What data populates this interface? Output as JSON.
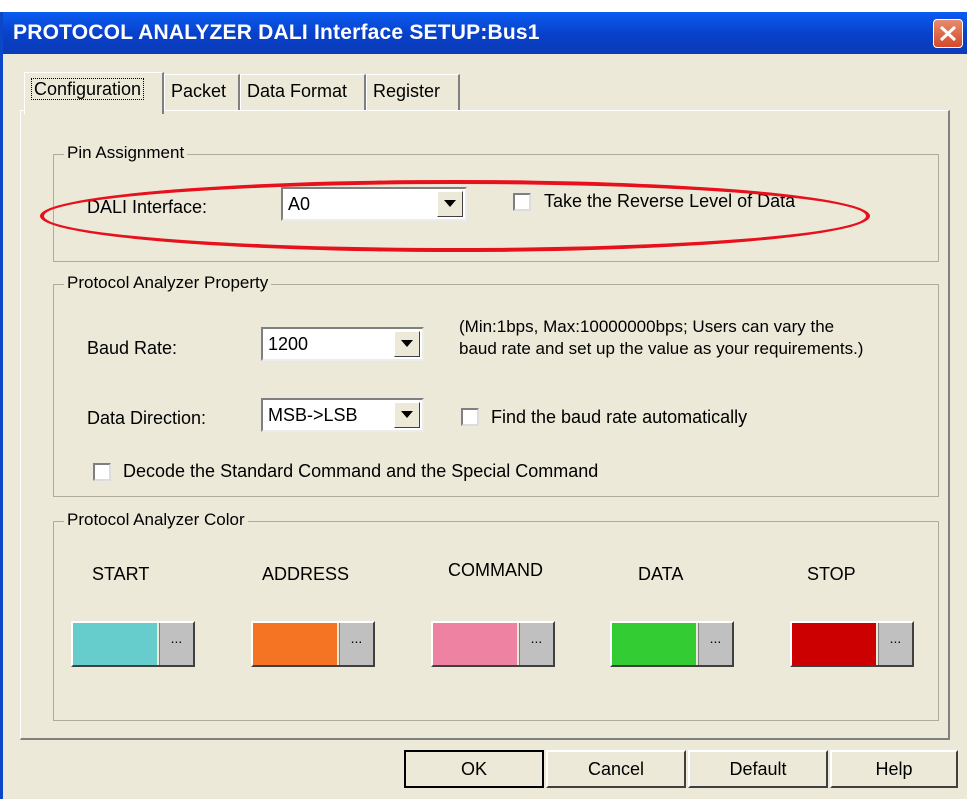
{
  "window": {
    "title": "PROTOCOL ANALYZER DALI Interface SETUP:Bus1"
  },
  "tabs": [
    {
      "label": "Configuration",
      "active": true
    },
    {
      "label": "Packet"
    },
    {
      "label": "Data Format"
    },
    {
      "label": "Register"
    }
  ],
  "pin_assignment": {
    "group_label": "Pin Assignment",
    "dali_interface_label": "DALI Interface:",
    "dali_interface_value": "A0",
    "reverse_level_label": "Take the Reverse Level of Data",
    "reverse_level_checked": false
  },
  "analyzer_property": {
    "group_label": "Protocol Analyzer Property",
    "baud_rate_label": "Baud Rate:",
    "baud_rate_value": "1200",
    "baud_rate_note_line1": "(Min:1bps, Max:10000000bps; Users can vary the",
    "baud_rate_note_line2": "baud rate and set up the value as your requirements.)",
    "data_direction_label": "Data Direction:",
    "data_direction_value": "MSB->LSB",
    "find_baud_label": "Find the baud rate automatically",
    "find_baud_checked": false,
    "decode_label": "Decode the Standard Command and the Special Command",
    "decode_checked": false
  },
  "analyzer_color": {
    "group_label": "Protocol Analyzer Color",
    "more_label": "...",
    "items": [
      {
        "label": "START",
        "color": "#66cccc"
      },
      {
        "label": "ADDRESS",
        "color": "#f57424"
      },
      {
        "label": "COMMAND",
        "color": "#ee82a2"
      },
      {
        "label": "DATA",
        "color": "#33cc33"
      },
      {
        "label": "STOP",
        "color": "#cc0000"
      }
    ]
  },
  "buttons": {
    "ok": "OK",
    "cancel": "Cancel",
    "default": "Default",
    "help": "Help"
  },
  "colors": {
    "title_bar": "#0840c8",
    "dialog_bg": "#ece9d8",
    "highlight_ellipse": "#e8101c"
  }
}
